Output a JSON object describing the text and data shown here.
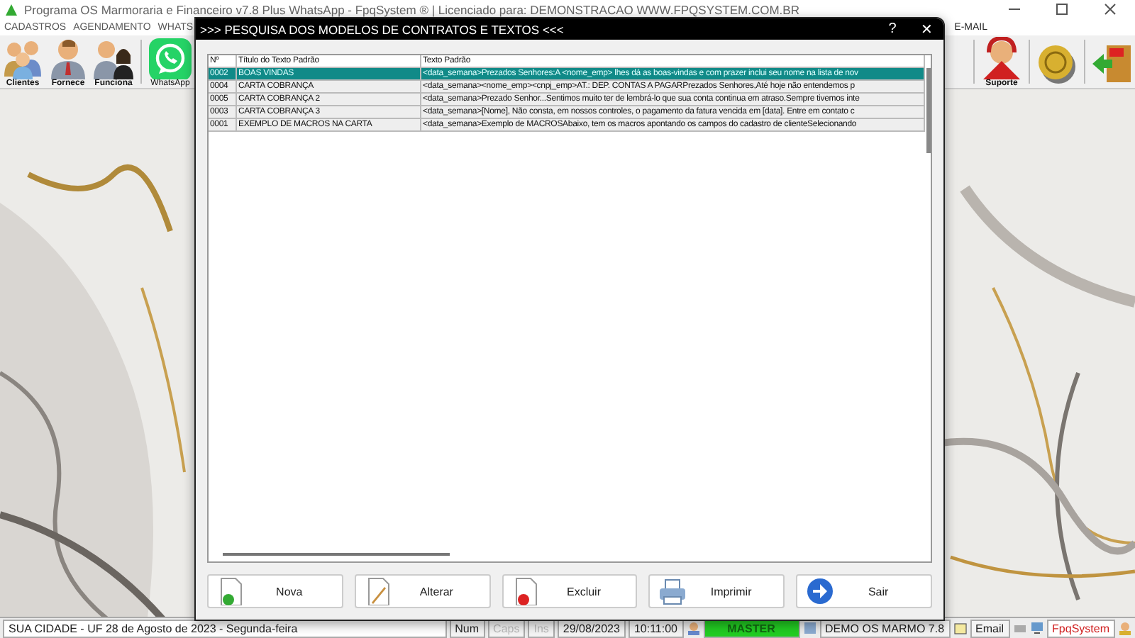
{
  "window": {
    "title": "Programa OS Marmoraria e Financeiro v7.8 Plus WhatsApp - FpqSystem ® | Licenciado para: DEMONSTRACAO WWW.FPQSYSTEM.COM.BR"
  },
  "menu": [
    "CADASTROS",
    "AGENDAMENTO",
    "WHATS",
    "E-MAIL"
  ],
  "toolbar_left": [
    {
      "label": "Clientes",
      "kind": "people"
    },
    {
      "label": "Fornece",
      "kind": "person"
    },
    {
      "label": "Funciona",
      "kind": "couple"
    },
    {
      "label": "WhatsApp",
      "kind": "whatsapp"
    }
  ],
  "toolbar_right": [
    {
      "label": "Suporte",
      "kind": "support"
    },
    {
      "kind": "coin"
    },
    {
      "kind": "exit"
    }
  ],
  "dialog": {
    "title": ">>>  PESQUISA DOS MODELOS DE CONTRATOS E TEXTOS <<<",
    "help": "?",
    "close": "✕",
    "table": {
      "columns": [
        "Nº",
        "Título do Texto Padrão",
        "Texto Padrão"
      ],
      "rows": [
        {
          "cells": [
            "0002",
            "BOAS VINDAS",
            "<data_semana>Prezados Senhores:A <nome_emp> lhes dá as boas-vindas e com prazer inclui seu nome na lista de nov"
          ],
          "selected": true
        },
        {
          "cells": [
            "0004",
            "CARTA COBRANÇA",
            "<data_semana><nome_emp><cnpj_emp>AT.: DEP. CONTAS A PAGARPrezados Senhores,Até hoje não entendemos p"
          ],
          "selected": false
        },
        {
          "cells": [
            "0005",
            "CARTA COBRANÇA 2",
            "<data_semana>Prezado Senhor...Sentimos muito ter de lembrá-lo que sua conta continua em atraso.Sempre tivemos inte"
          ],
          "selected": false
        },
        {
          "cells": [
            "0003",
            "CARTA COBRANÇA 3",
            "<data_semana>[Nome], Não consta, em nossos controles, o pagamento da fatura vencida em [data]. Entre em contato c"
          ],
          "selected": false
        },
        {
          "cells": [
            "0001",
            "EXEMPLO DE MACROS NA CARTA",
            "<data_semana>Exemplo de MACROSAbaixo, tem os macros apontando os campos do cadastro de clienteSelecionando"
          ],
          "selected": false
        }
      ]
    },
    "buttons": [
      {
        "label": "Nova",
        "kind": "new"
      },
      {
        "label": "Alterar",
        "kind": "edit"
      },
      {
        "label": "Excluir",
        "kind": "delete"
      },
      {
        "label": "Imprimir",
        "kind": "print"
      },
      {
        "label": "Sair",
        "kind": "exit"
      }
    ]
  },
  "status_bar": {
    "location": "SUA CIDADE - UF 28 de Agosto de 2023 - Segunda-feira",
    "keys": [
      {
        "label": "Num",
        "on": true
      },
      {
        "label": "Caps",
        "on": false
      },
      {
        "label": "Ins",
        "on": false
      }
    ],
    "date": "29/08/2023",
    "time": "10:11:00",
    "user": "MASTER",
    "company": "DEMO OS MARMO 7.8",
    "email": "Email",
    "brand": "FpqSystem"
  }
}
